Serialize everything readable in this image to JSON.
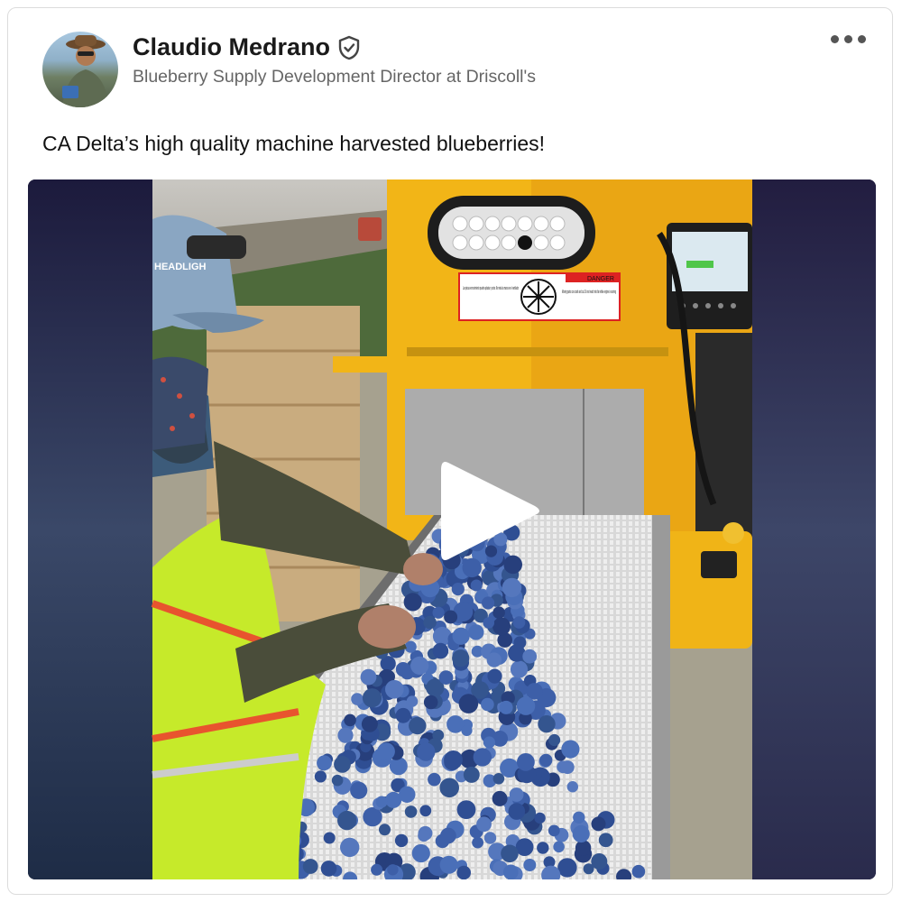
{
  "post": {
    "author_name": "Claudio Medrano",
    "author_headline": "Blueberry Supply Development Director at Driscoll's",
    "text": "CA Delta’s high quality machine harvested blueberries!",
    "verified_icon": "shield-check-icon",
    "menu_icon": "more-horizontal-icon"
  },
  "video": {
    "play_icon": "play-icon",
    "headlamp_text": "HEADLIGH",
    "warning_heading": "DANGER",
    "warning_es": "Las piezas en movimiento pueden aplastar y cortar. No meta las manos en el ventilador",
    "warning_en": "Moving parts can crush and cut. Do not reach into fan while engine is running"
  },
  "colors": {
    "machine_yellow": "#f2b517",
    "vest_green": "#c6ea2a",
    "berry_blue": "#3d5fa8",
    "frame_dark": "#1b1a38"
  }
}
